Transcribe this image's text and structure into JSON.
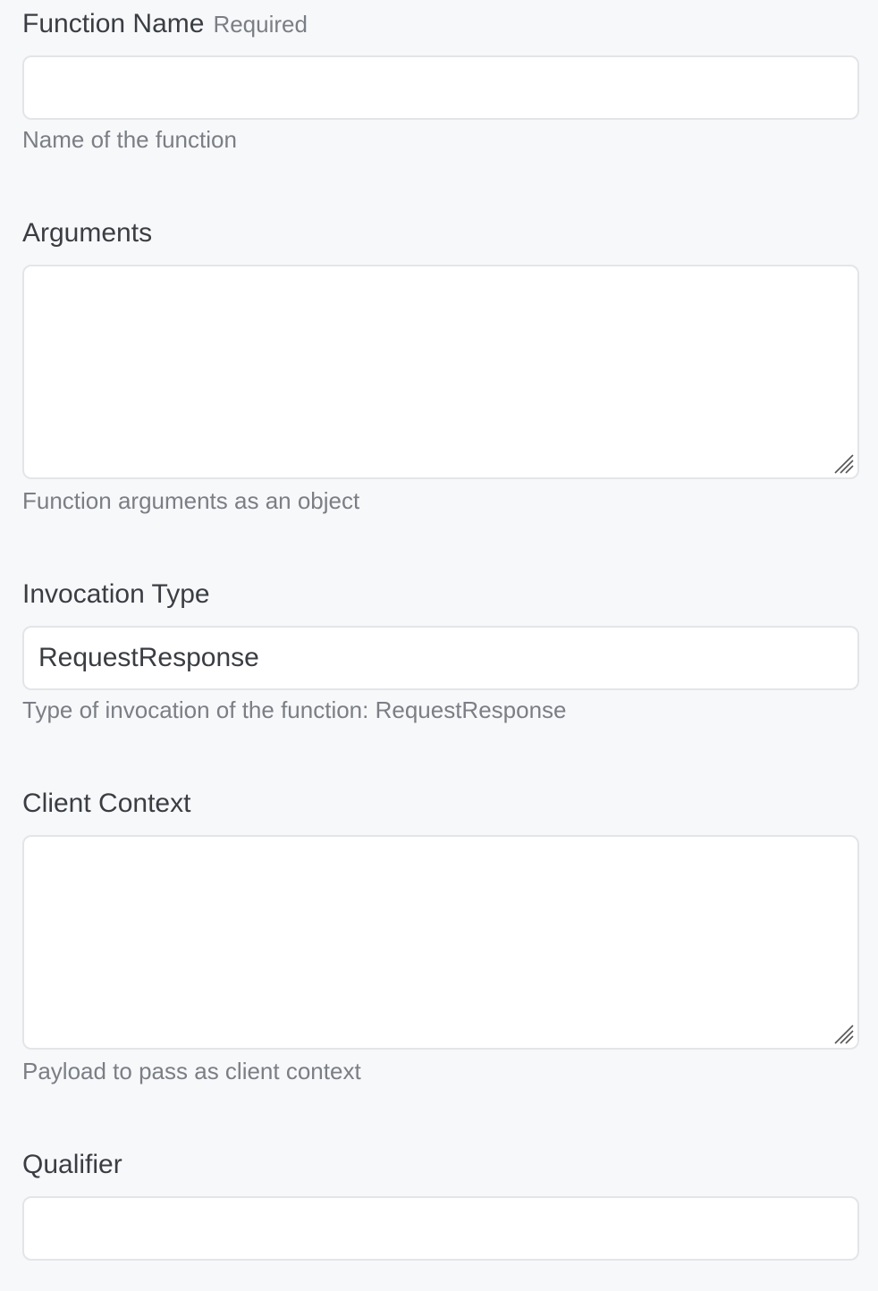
{
  "form": {
    "function_name": {
      "label": "Function Name",
      "required_tag": "Required",
      "value": "",
      "help": "Name of the function"
    },
    "arguments": {
      "label": "Arguments",
      "value": "",
      "help": "Function arguments as an object"
    },
    "invocation_type": {
      "label": "Invocation Type",
      "value": "RequestResponse",
      "help": "Type of invocation of the function: RequestResponse"
    },
    "client_context": {
      "label": "Client Context",
      "value": "",
      "help": "Payload to pass as client context"
    },
    "qualifier": {
      "label": "Qualifier",
      "value": ""
    }
  }
}
